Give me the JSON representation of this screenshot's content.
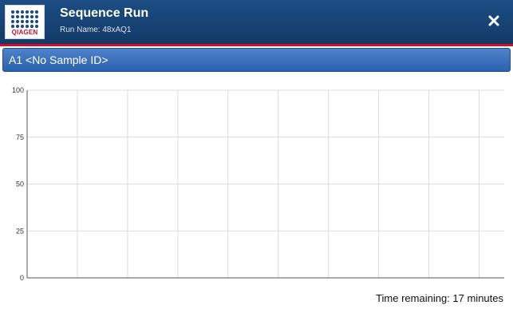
{
  "header": {
    "brand": "QIAGEN",
    "title": "Sequence Run",
    "subtitle": "Run Name: 48xAQ1",
    "close_icon": "close-icon",
    "background_color": "#16436f",
    "rule_color": "#c8102e"
  },
  "sample": {
    "label": "A1  <No Sample ID>",
    "bar_color": "#3a6fb9"
  },
  "status": {
    "time_remaining": "Time remaining: 17 minutes"
  },
  "chart_data": {
    "type": "line",
    "title": "",
    "xlabel": "",
    "ylabel": "",
    "ylim": [
      0,
      100
    ],
    "yticks": [
      0,
      25,
      50,
      75,
      100
    ],
    "x_gridlines": 9,
    "grid": true,
    "series": []
  }
}
